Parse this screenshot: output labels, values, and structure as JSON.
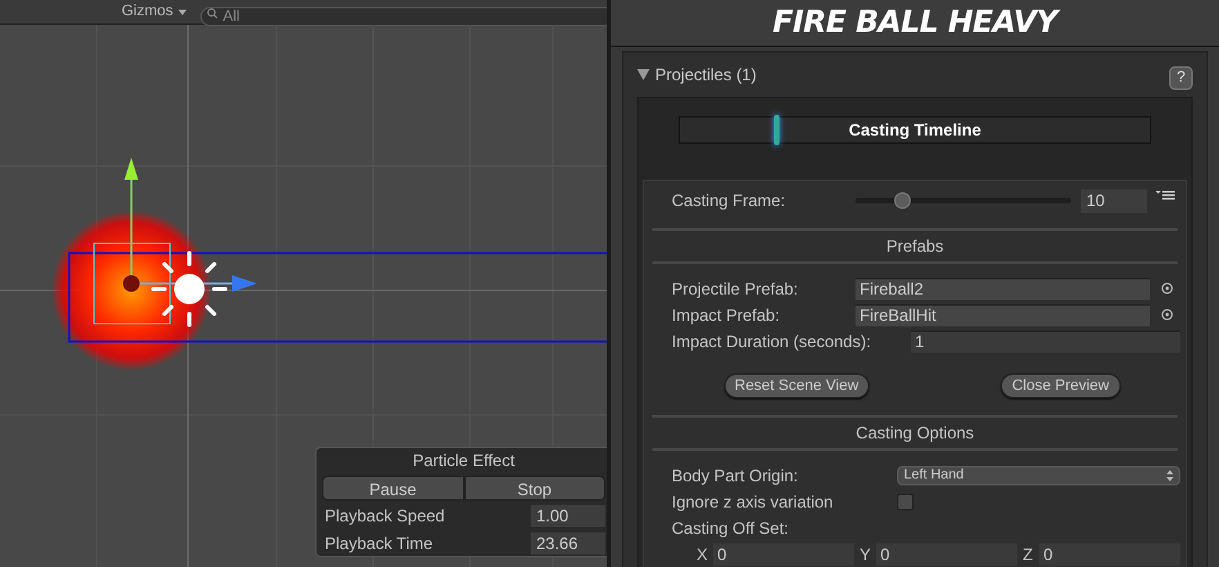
{
  "scene_toolbar": {
    "gizmos": "Gizmos",
    "search": {
      "placeholder": "All"
    }
  },
  "particle_effect": {
    "title": "Particle Effect",
    "buttons": [
      "Pause",
      "Stop"
    ],
    "fields": [
      {
        "label": "Playback Speed",
        "value": "1.00"
      },
      {
        "label": "Playback Time",
        "value": "23.66"
      }
    ]
  },
  "inspector": {
    "title": "FIRE BALL HEAVY",
    "section": {
      "title": "Projectiles (1)",
      "expanded": true,
      "help": "?"
    },
    "timeline": {
      "label": "Casting Timeline",
      "level": 0.2
    },
    "casting_frame": {
      "label": "Casting Frame:",
      "level": 0.22,
      "value": "10"
    },
    "groups": [
      {
        "title": "Prefabs",
        "rows": [
          {
            "kind": "object",
            "label": "Projectile Prefab:",
            "value": "Fireball2"
          },
          {
            "kind": "object",
            "label": "Impact Prefab:",
            "value": "FireBallHit"
          },
          {
            "kind": "number",
            "label": "Impact Duration (seconds):",
            "value": "1"
          }
        ],
        "buttons": [
          "Reset Scene View",
          "Close Preview"
        ]
      },
      {
        "title": "Casting Options",
        "rows": [
          {
            "kind": "dropdown",
            "label": "Body Part Origin:",
            "value": "Left Hand"
          },
          {
            "kind": "checkbox",
            "label": "Ignore z axis variation",
            "checked": false
          },
          {
            "kind": "heading",
            "label": "Casting Off Set:"
          },
          {
            "kind": "vector",
            "fields": [
              {
                "axis": "X",
                "value": "0"
              },
              {
                "axis": "Y",
                "value": "0"
              },
              {
                "axis": "Z",
                "value": "0"
              }
            ]
          }
        ]
      }
    ]
  }
}
